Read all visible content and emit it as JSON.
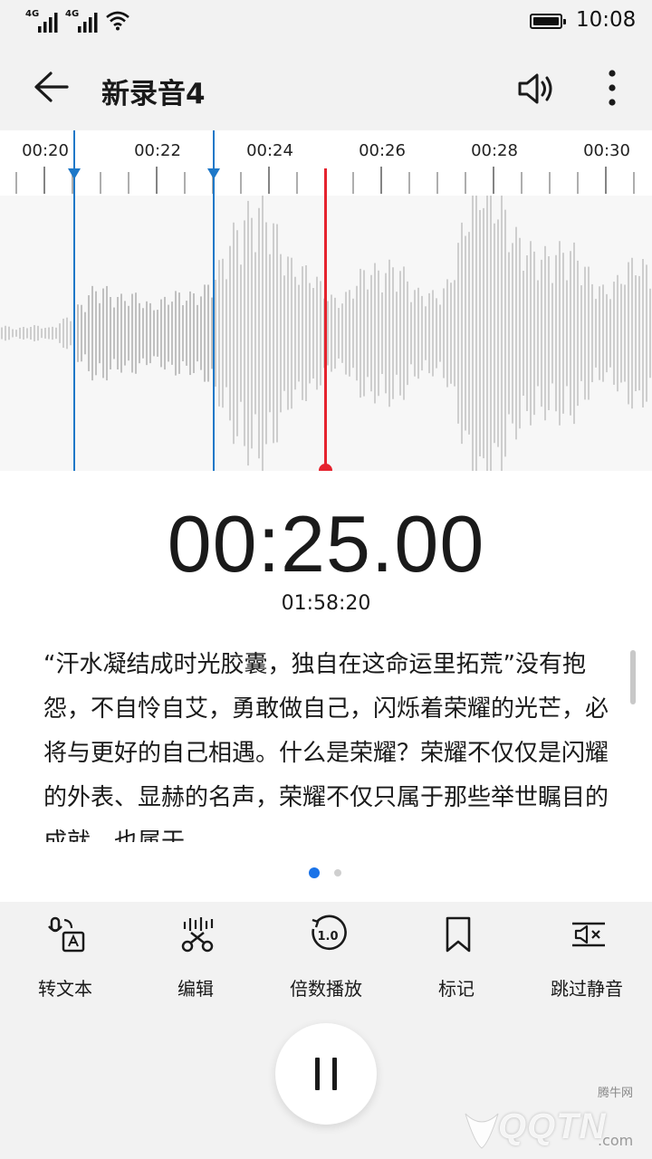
{
  "status_bar": {
    "sim1_label": "4G",
    "sim2_label": "4G",
    "time": "10:08"
  },
  "header": {
    "title": "新录音4",
    "back_icon": "arrow-left-icon",
    "speaker_icon": "speaker-icon",
    "more_icon": "more-vertical-icon"
  },
  "timeline": {
    "labels": [
      "00:20",
      "00:22",
      "00:24",
      "00:26",
      "00:28",
      "00:30"
    ]
  },
  "playback": {
    "current_time": "00:25.00",
    "total_time": "01:58:20"
  },
  "transcript": {
    "text": "“汗水凝结成时光胶囊，独自在这命运里拓荒”没有抱怨，不自怜自艾，勇敢做自己，闪烁着荣耀的光芒，必将与更好的自己相遇。什么是荣耀？荣耀不仅仅是闪耀的外表、显赫的名声，荣耀不仅只属于那些举世瞩目的成就，也属于"
  },
  "pager": {
    "page_count": 2,
    "active_page": 1
  },
  "toolbar": {
    "items": [
      {
        "label": "转文本",
        "icon": "speech-to-text-icon"
      },
      {
        "label": "编辑",
        "icon": "scissors-edit-icon"
      },
      {
        "label": "倍数播放",
        "icon": "playback-speed-icon"
      },
      {
        "label": "标记",
        "icon": "bookmark-icon"
      },
      {
        "label": "跳过静音",
        "icon": "skip-silence-icon"
      }
    ],
    "pause_icon": "pause-icon"
  },
  "watermark": {
    "text": "QQTN",
    "small_text": "腾牛网",
    "suffix": ".com"
  },
  "colors": {
    "accent_blue": "#1e78c8",
    "playhead_red": "#e5232e",
    "pager_active": "#1a73e8"
  }
}
